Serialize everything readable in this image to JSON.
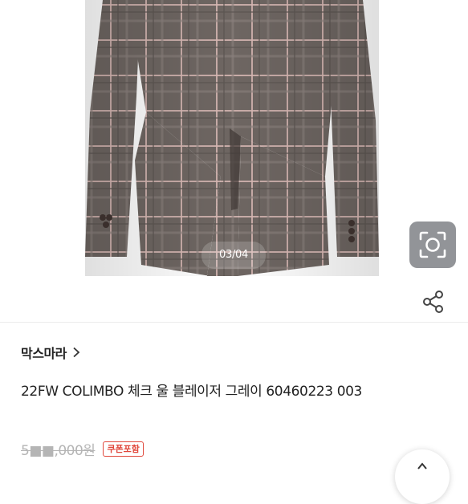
{
  "gallery": {
    "counter": "03/04",
    "current_index": 3,
    "total": 4
  },
  "icons": {
    "lens": "camera-lens-search-icon",
    "share": "share-icon",
    "chevron": "chevron-right-icon"
  },
  "product": {
    "brand": "막스마라",
    "title": "22FW COLIMBO 체크 울 블레이저 그레이 60460223 003",
    "original_price": "5■■,000원",
    "coupon_badge": "쿠폰포함"
  },
  "colors": {
    "jacket": "#6b6360",
    "coupon": "#e0473b",
    "text": "#222222"
  }
}
